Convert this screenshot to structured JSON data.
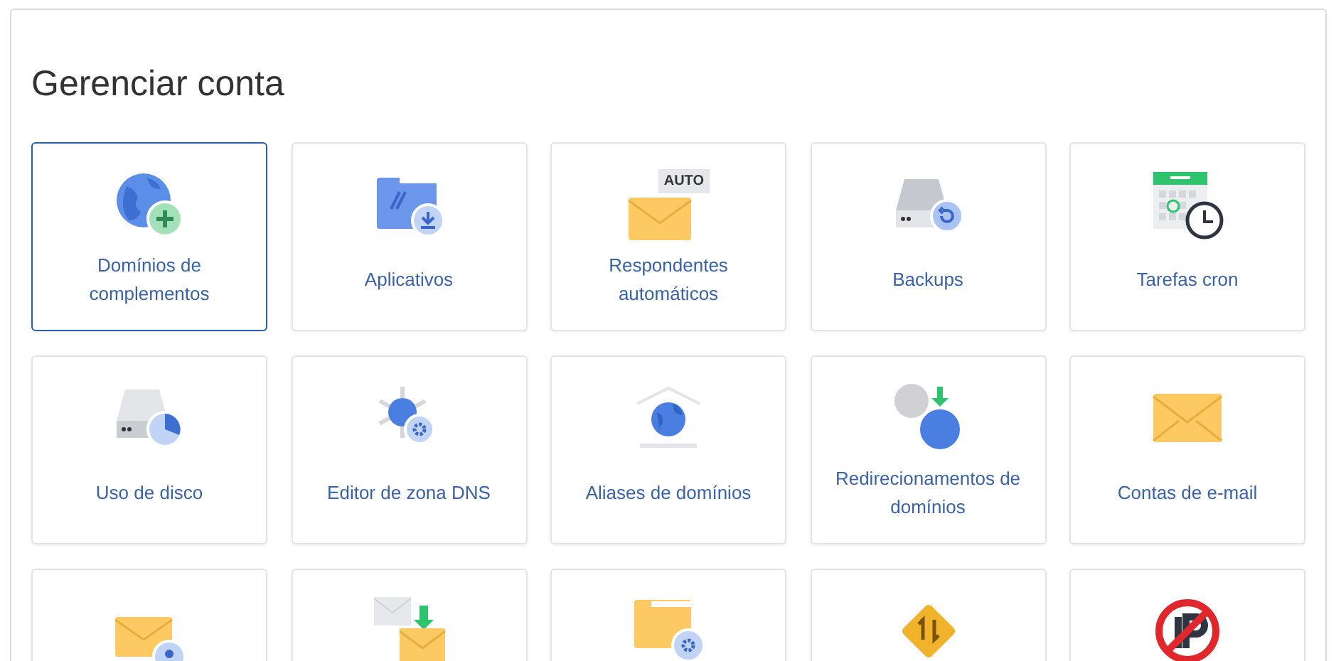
{
  "title": "Gerenciar conta",
  "items": [
    {
      "kind": "addon-globe",
      "label": "Domínios de complementos",
      "selected": true
    },
    {
      "kind": "apps-folder",
      "label": "Aplicativos",
      "selected": false
    },
    {
      "kind": "autoresponder",
      "label": "Respondentes automáticos",
      "selected": false,
      "badge": "AUTO"
    },
    {
      "kind": "backup",
      "label": "Backups",
      "selected": false
    },
    {
      "kind": "cron",
      "label": "Tarefas cron",
      "selected": false
    },
    {
      "kind": "disk",
      "label": "Uso de disco",
      "selected": false
    },
    {
      "kind": "dns",
      "label": "Editor de zona DNS",
      "selected": false
    },
    {
      "kind": "alias",
      "label": "Aliases de domínios",
      "selected": false
    },
    {
      "kind": "redirect",
      "label": "Redirecionamentos de domínios",
      "selected": false
    },
    {
      "kind": "email",
      "label": "Contas de e-mail",
      "selected": false
    },
    {
      "kind": "email-key",
      "selected": false
    },
    {
      "kind": "email-import",
      "selected": false
    },
    {
      "kind": "folder-gear",
      "selected": false
    },
    {
      "kind": "traffic",
      "selected": false
    },
    {
      "kind": "ip-block",
      "selected": false
    }
  ]
}
